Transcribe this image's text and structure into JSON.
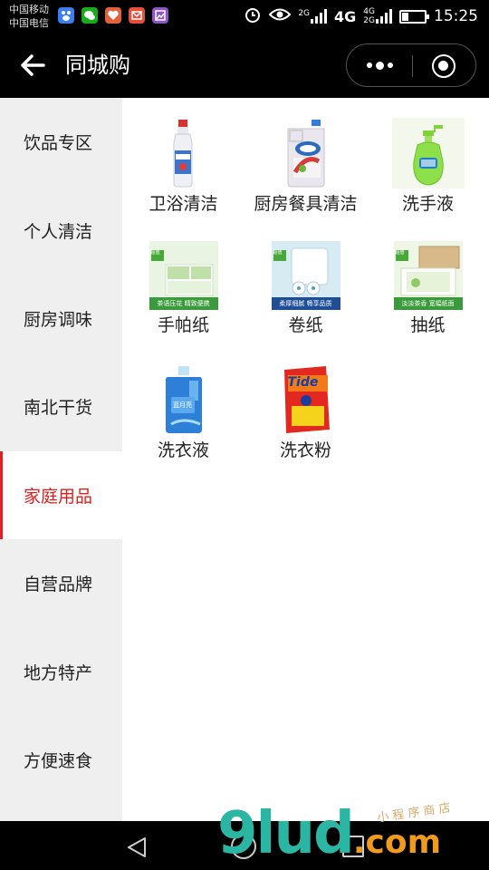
{
  "status_bar": {
    "carrier_1": "中国移动",
    "carrier_2": "中国电信",
    "notification_icons": [
      "baidu-icon",
      "wechat-icon",
      "health-icon",
      "mail-icon",
      "gallery-icon"
    ],
    "net_1": "2G",
    "net_2": "4G",
    "net_3a": "4G",
    "net_3b": "2G",
    "time": "15:25"
  },
  "header": {
    "title": "同城购"
  },
  "sidebar": {
    "active_index": 4,
    "items": [
      {
        "label": "饮品专区"
      },
      {
        "label": "个人清洁"
      },
      {
        "label": "厨房调味"
      },
      {
        "label": "南北干货"
      },
      {
        "label": "家庭用品"
      },
      {
        "label": "自营品牌"
      },
      {
        "label": "地方特产"
      },
      {
        "label": "方便速食"
      }
    ]
  },
  "products": [
    {
      "name": "卫浴清洁",
      "image": "toilet-cleaner-bottle"
    },
    {
      "name": "厨房餐具清洁",
      "image": "dish-detergent-jug"
    },
    {
      "name": "洗手液",
      "image": "hand-soap-pump"
    },
    {
      "name": "手帕纸",
      "image": "pocket-tissue-pack",
      "banner": "茶语压花 精致便携",
      "tag": "超值"
    },
    {
      "name": "卷纸",
      "image": "toilet-roll-pack",
      "banner": "柔厚细腻 畅享品质",
      "tag": "超值"
    },
    {
      "name": "抽纸",
      "image": "facial-tissue-box",
      "banner": "淡淡茶香 宽幅纸面",
      "tag": "超值"
    },
    {
      "name": "洗衣液",
      "image": "laundry-liquid-bottle",
      "label": "蓝月亮"
    },
    {
      "name": "洗衣粉",
      "image": "laundry-powder-bag",
      "label": "Tide"
    }
  ],
  "watermark": {
    "main": "9lud",
    "domain": ".com",
    "sub": "小 程 序 商 店"
  },
  "colors": {
    "active": "#e0201e",
    "sidebar_bg": "#efefef",
    "header_bg": "#000000",
    "watermark_teal": "#2bb6a4",
    "watermark_orange": "#f29a1c"
  }
}
